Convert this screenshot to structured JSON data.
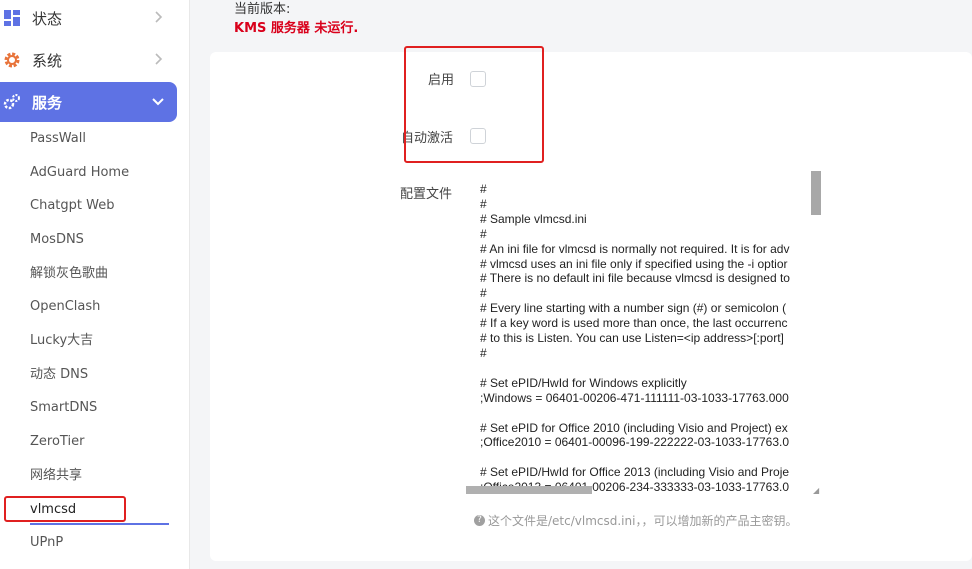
{
  "sidebar": {
    "main_items": [
      {
        "label": "状态",
        "icon": "dashboard-icon"
      },
      {
        "label": "系统",
        "icon": "gear-icon"
      },
      {
        "label": "服务",
        "icon": "services-gears-icon"
      }
    ],
    "sub_items": [
      "PassWall",
      "AdGuard Home",
      "Chatgpt Web",
      "MosDNS",
      "解锁灰色歌曲",
      "OpenClash",
      "Lucky大吉",
      "动态 DNS",
      "SmartDNS",
      "ZeroTier",
      "网络共享",
      "vlmcsd",
      "UPnP"
    ],
    "selected_sub_item": "vlmcsd"
  },
  "header": {
    "version_label": "当前版本:",
    "status_text": "KMS 服务器 未运行."
  },
  "form": {
    "enable_label": "启用",
    "enable_checked": false,
    "autoactivate_label": "自动激活",
    "autoactivate_checked": false,
    "config_label": "配置文件",
    "config_text": "#\n#\n# Sample vlmcsd.ini\n#\n# An ini file for vlmcsd is normally not required. It is for adv\n# vlmcsd uses an ini file only if specified using the -i optior\n# There is no default ini file because vlmcsd is designed to\n#\n# Every line starting with a number sign (#) or semicolon (\n# If a key word is used more than once, the last occurrenc\n# to this is Listen. You can use Listen=<ip address>[:port]\n#\n\n# Set ePID/HwId for Windows explicitly\n;Windows = 06401-00206-471-111111-03-1033-17763.000\n\n# Set ePID for Office 2010 (including Visio and Project) ex\n;Office2010 = 06401-00096-199-222222-03-1033-17763.0\n\n# Set ePID/HwId for Office 2013 (including Visio and Proje\n;Office2013 = 06401-00206-234-333333-03-1033-17763.0",
    "hint_icon": "question-circle-icon",
    "hint_text": "这个文件是/etc/vlmcsd.ini，，可以增加新的产品主密钥。"
  },
  "colors": {
    "accent": "#5e72e4",
    "status_red": "#d9001b",
    "highlight_box": "#e02020"
  }
}
